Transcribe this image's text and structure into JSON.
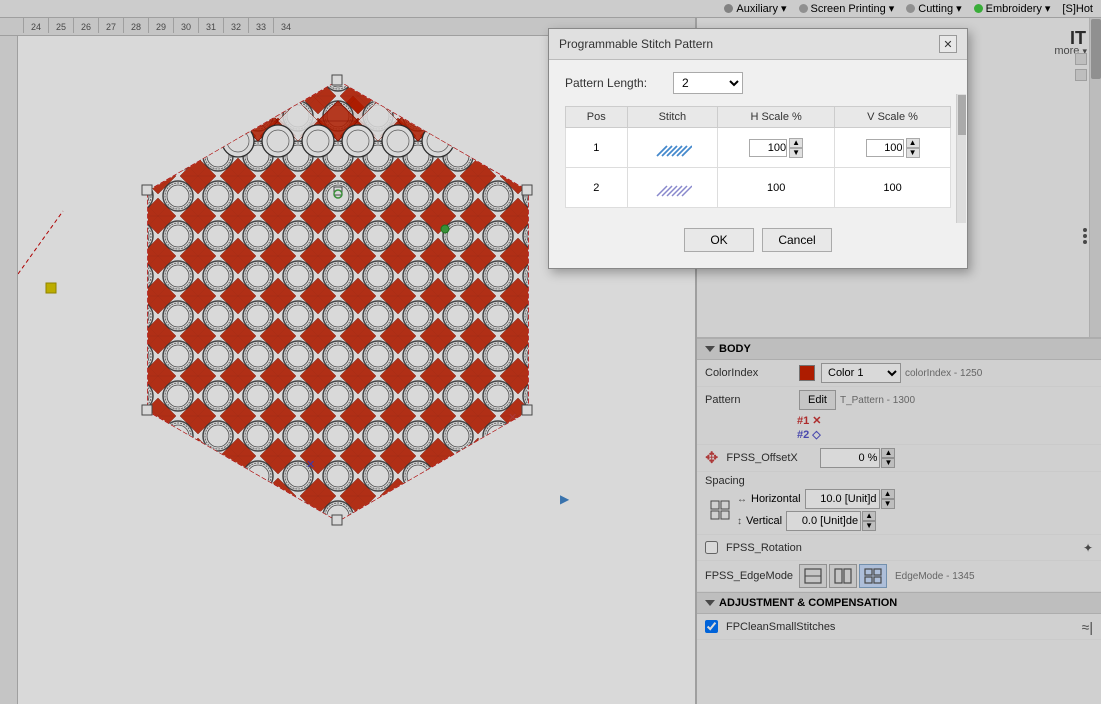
{
  "topbar": {
    "items": [
      {
        "id": "auxiliary",
        "label": "Auxiliary",
        "dot_color": "gray",
        "arrow": "▾"
      },
      {
        "id": "screen-printing",
        "label": "Screen Printing",
        "dot_color": "gray2",
        "arrow": "▾"
      },
      {
        "id": "cutting",
        "label": "Cutting",
        "dot_color": "gray2",
        "arrow": "▾"
      },
      {
        "id": "embroidery",
        "label": "Embroidery",
        "dot_color": "green",
        "arrow": "▾"
      },
      {
        "id": "shot",
        "label": "[S]Hot",
        "arrow": ""
      }
    ]
  },
  "ruler": {
    "marks": [
      "24",
      "25",
      "26",
      "27",
      "28",
      "29",
      "30",
      "31",
      "32",
      "33",
      "34"
    ]
  },
  "dialog": {
    "title": "Programmable Stitch Pattern",
    "pattern_length_label": "Pattern Length:",
    "pattern_length_value": "2",
    "table": {
      "headers": [
        "Pos",
        "Stitch",
        "H Scale %",
        "V Scale %"
      ],
      "rows": [
        {
          "pos": "1",
          "h_scale": "100",
          "v_scale": "100",
          "has_spin": true
        },
        {
          "pos": "2",
          "h_scale": "100",
          "v_scale": "100",
          "has_spin": false
        }
      ]
    },
    "ok_label": "OK",
    "cancel_label": "Cancel"
  },
  "properties": {
    "body_label": "BODY",
    "color_index_label": "ColorIndex",
    "color_name": "Color 1",
    "color_suffix": "colorIndex - 1250",
    "pattern_label": "Pattern",
    "pattern_items": [
      "#1 X",
      "#2 ◇"
    ],
    "edit_label": "Edit",
    "pattern_suffix": "T_Pattern - 1300",
    "fpss_offset_x_label": "FPSS_OffsetX",
    "fpss_offset_x_value": "0 %",
    "spacing_label": "Spacing",
    "horizontal_label": "Horizontal",
    "horizontal_value": "10.0 [Unit]d",
    "vertical_label": "Vertical",
    "vertical_value": "0.0 [Unit]de",
    "fpss_rotation_label": "FPSS_Rotation",
    "fpss_edge_mode_label": "FPSS_EdgeMode",
    "edge_mode_suffix": "EdgeMode - 1345",
    "it_label": "IT",
    "more_label": "more",
    "adjustment_label": "ADJUSTMENT & COMPENSATION",
    "fp_clean_label": "FPCleanSmallStitches"
  }
}
